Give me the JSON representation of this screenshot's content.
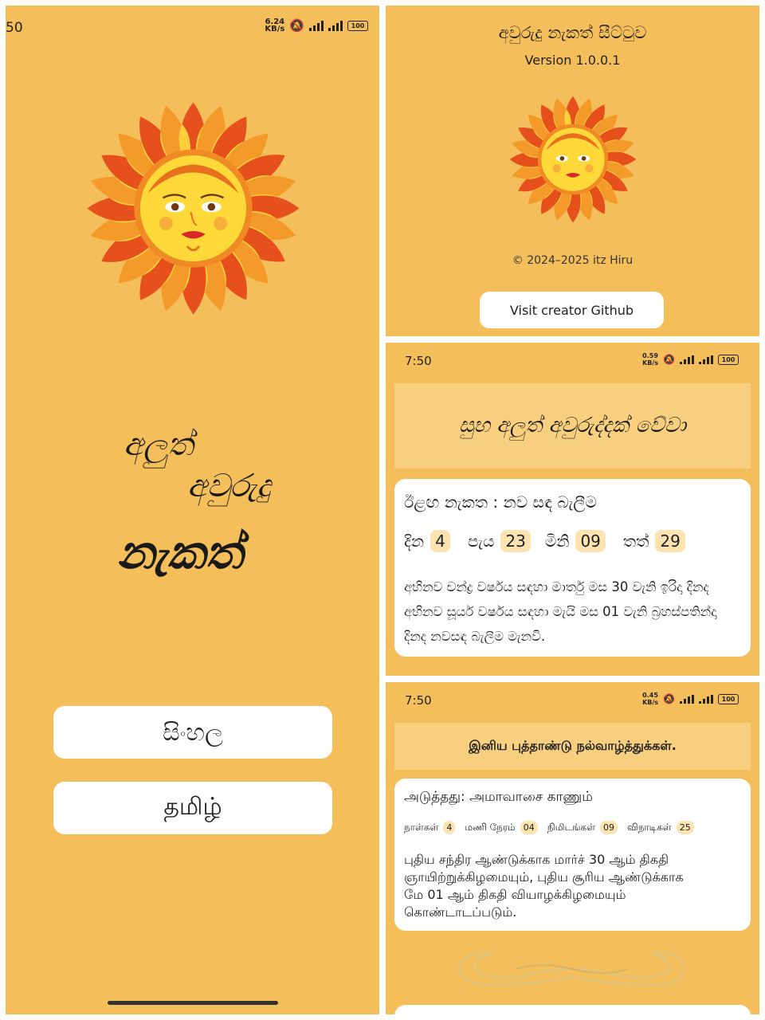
{
  "home": {
    "status_time": "50",
    "net_speed": "6.24\nKB/s",
    "title_line1": "අලුත්",
    "title_line2": "අවුරුදු",
    "title_line3": "නැකත්",
    "btn_sinhala": "සිංහල",
    "btn_tamil": "தமிழ்"
  },
  "about": {
    "app_title": "අවුරුදු නැකත් සීට්ටුව",
    "version": "Version 1.0.0.1",
    "copyright": "© 2024–2025 itz Hiru",
    "github_button": "Visit creator Github"
  },
  "sinhala": {
    "status_time": "7:50",
    "net_speed": "0.59\nKB/s",
    "greeting": "සුභ අලුත් අවුරුද්දක් වේවා",
    "next_label": "ඊළඟ නැකත : නව සඳ බැලීම",
    "days_label": "දින",
    "days": "4",
    "hours_label": "පැය",
    "hours": "23",
    "minutes_label": "මිනි",
    "minutes": "09",
    "seconds_label": "තත්",
    "seconds": "29",
    "description": "අභිනව චන්ද්‍ර වර්ෂය සඳහා මාර්තු මස 30 වැනි ඉරිදා දිනද අභිනව සූර්ය වර්ෂය සඳහා මැයි මස 01 වැනි බ්‍රහස්පතින්දා දිනද නවසඳ බැලීම මැනවි."
  },
  "tamil": {
    "status_time": "7:50",
    "net_speed": "0.45\nKB/s",
    "greeting": "இனிய புத்தாண்டு நல்வாழ்த்துக்கள்.",
    "next_label": "அடுத்தது: அமாவாசை காணும்",
    "days_label": "நாள்கள்",
    "days": "4",
    "hours_label": "மணி நேரம்",
    "hours": "04",
    "minutes_label": "நிமிடங்கள்",
    "minutes": "09",
    "seconds_label": "விநாடிகள்",
    "seconds": "25",
    "description": "புதிய சந்திர ஆண்டுக்காக மார்ச் 30 ஆம் திகதி ஞாயிற்றுக்கிழமையும், புதிய சூரிய ஆண்டுக்காக மே 01 ஆம் திகதி வியாழக்கிழமையும் கொண்டாடப்படும்."
  },
  "battery": "100",
  "colors": {
    "background": "#f4bf5a",
    "banner": "#f7cf7e",
    "chip": "#fce3b0",
    "sun_outer": "#e8531f",
    "sun_face": "#ffd83a"
  }
}
